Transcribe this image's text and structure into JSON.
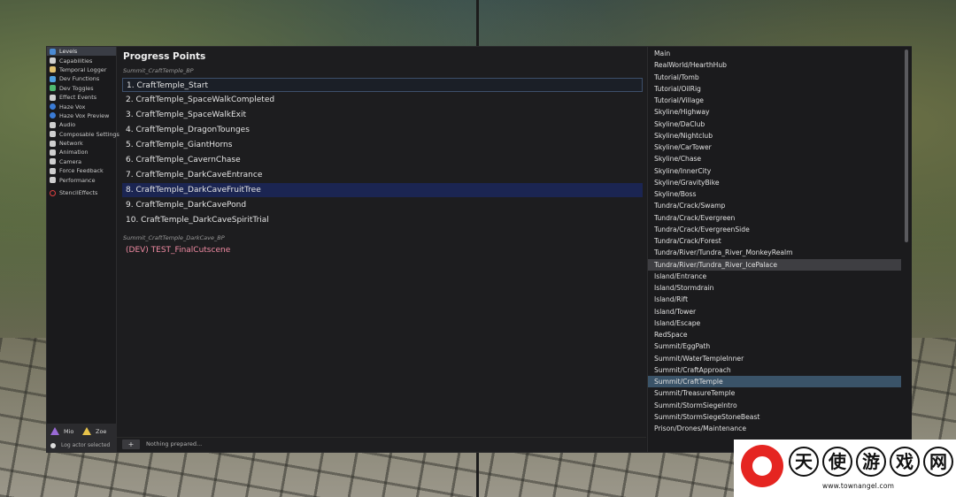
{
  "sidebar": {
    "items": [
      {
        "label": "Levels",
        "icon": "levels-icon",
        "color": "#4a8ad4",
        "active": true
      },
      {
        "label": "Capabilities",
        "icon": "capabilities-icon",
        "color": "#cfcfcf"
      },
      {
        "label": "Temporal Logger",
        "icon": "hourglass-icon",
        "color": "#e0c070"
      },
      {
        "label": "Dev Functions",
        "icon": "function-icon",
        "color": "#4fa0e0"
      },
      {
        "label": "Dev Toggles",
        "icon": "checkbox-icon",
        "color": "#4fb870"
      },
      {
        "label": "Effect Events",
        "icon": "effect-icon",
        "color": "#d0d0d0"
      },
      {
        "label": "Haze Vox",
        "icon": "globe-icon",
        "color": "#3a7bd5"
      },
      {
        "label": "Haze Vox Preview",
        "icon": "globe-preview-icon",
        "color": "#3a7bd5"
      },
      {
        "label": "Audio",
        "icon": "audio-icon",
        "color": "#cfcfcf"
      },
      {
        "label": "Composable Settings",
        "icon": "gear-icon",
        "color": "#cfcfcf"
      },
      {
        "label": "Network",
        "icon": "network-icon",
        "color": "#cfcfcf"
      },
      {
        "label": "Animation",
        "icon": "animation-icon",
        "color": "#cfcfcf"
      },
      {
        "label": "Camera",
        "icon": "camera-icon",
        "color": "#cfcfcf"
      },
      {
        "label": "Force Feedback",
        "icon": "controller-icon",
        "color": "#cfcfcf"
      },
      {
        "label": "Performance",
        "icon": "performance-icon",
        "color": "#cfcfcf"
      },
      {
        "label": "StencilEffects",
        "icon": "stencil-icon",
        "color": "#e04040"
      }
    ],
    "players": [
      {
        "label": "Mio",
        "color": "#9a6ad6"
      },
      {
        "label": "Zoe",
        "color": "#e6c24a"
      }
    ],
    "log_text": "Log actor selected"
  },
  "progress": {
    "title": "Progress Points",
    "group1": "Summit_CraftTemple_BP",
    "points": [
      "1. CraftTemple_Start",
      "2. CraftTemple_SpaceWalkCompleted",
      "3. CraftTemple_SpaceWalkExit",
      "4. CraftTemple_DragonTounges",
      "5. CraftTemple_GiantHorns",
      "6. CraftTemple_CavernChase",
      "7. CraftTemple_DarkCaveEntrance",
      "8. CraftTemple_DarkCaveFruitTree",
      "9. CraftTemple_DarkCavePond",
      "10. CraftTemple_DarkCaveSpiritTrial"
    ],
    "group2": "Summit_CraftTemple_DarkCave_BP",
    "dev_point": "(DEV) TEST_FinalCutscene",
    "add_label": "+",
    "status": "Nothing prepared..."
  },
  "levels": [
    "Main",
    "RealWorld/HearthHub",
    "Tutorial/Tomb",
    "Tutorial/OilRig",
    "Tutorial/Village",
    "Skyline/Highway",
    "Skyline/DaClub",
    "Skyline/Nightclub",
    "Skyline/CarTower",
    "Skyline/Chase",
    "Skyline/InnerCity",
    "Skyline/GravityBike",
    "Skyline/Boss",
    "Tundra/Crack/Swamp",
    "Tundra/Crack/Evergreen",
    "Tundra/Crack/EvergreenSide",
    "Tundra/Crack/Forest",
    "Tundra/River/Tundra_River_MonkeyRealm",
    "Tundra/River/Tundra_River_IcePalace",
    "Island/Entrance",
    "Island/Stormdrain",
    "Island/Rift",
    "Island/Tower",
    "Island/Escape",
    "RedSpace",
    "Summit/EggPath",
    "Summit/WaterTempleInner",
    "Summit/CraftApproach",
    "Summit/CraftTemple",
    "Summit/TreasureTemple",
    "Summit/StormSiegeIntro",
    "Summit/StormSiegeStoneBeast",
    "Prison/Drones/Maintenance"
  ],
  "levels_hover": "Tundra/River/Tundra_River_IcePalace",
  "levels_active": "Summit/CraftTemple",
  "watermark": {
    "chars": [
      "天",
      "使",
      "游",
      "戏",
      "网"
    ],
    "url": "www.townangel.com"
  }
}
